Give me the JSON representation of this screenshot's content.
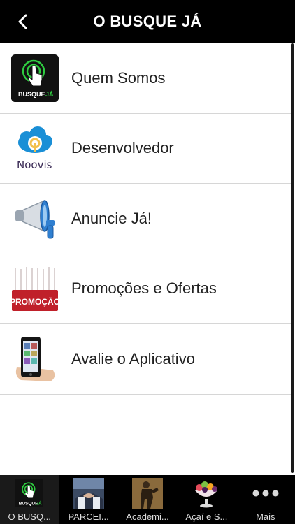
{
  "header": {
    "title": "O BUSQUE JÁ",
    "back_icon": "chevron-left-icon"
  },
  "logo_text": {
    "busque": "BUSQUE",
    "ja": "JÁ",
    "noovis": "Noovis",
    "promocao": "PROMOÇÃO"
  },
  "menu": {
    "items": [
      {
        "label": "Quem Somos",
        "icon": "busque-ja-logo-icon"
      },
      {
        "label": "Desenvolvedor",
        "icon": "noovis-logo-icon"
      },
      {
        "label": "Anuncie Já!",
        "icon": "megaphone-icon"
      },
      {
        "label": "Promoções e Ofertas",
        "icon": "promocao-tags-icon"
      },
      {
        "label": "Avalie o Aplicativo",
        "icon": "smartphone-icon"
      }
    ]
  },
  "tabbar": {
    "tabs": [
      {
        "label": "O BUSQ...",
        "icon": "busque-ja-logo-icon",
        "active": true
      },
      {
        "label": "PARCEI...",
        "icon": "handshake-icon",
        "active": false
      },
      {
        "label": "Academi...",
        "icon": "fitness-icon",
        "active": false
      },
      {
        "label": "Açaí e S...",
        "icon": "acai-bowl-icon",
        "active": false
      },
      {
        "label": "Mais",
        "icon": "more-dots-icon",
        "active": false
      }
    ]
  },
  "colors": {
    "header_bg": "#000000",
    "accent_green": "#2ecc40",
    "promo_red": "#c0202a",
    "noovis_blue": "#1a8fd6"
  }
}
